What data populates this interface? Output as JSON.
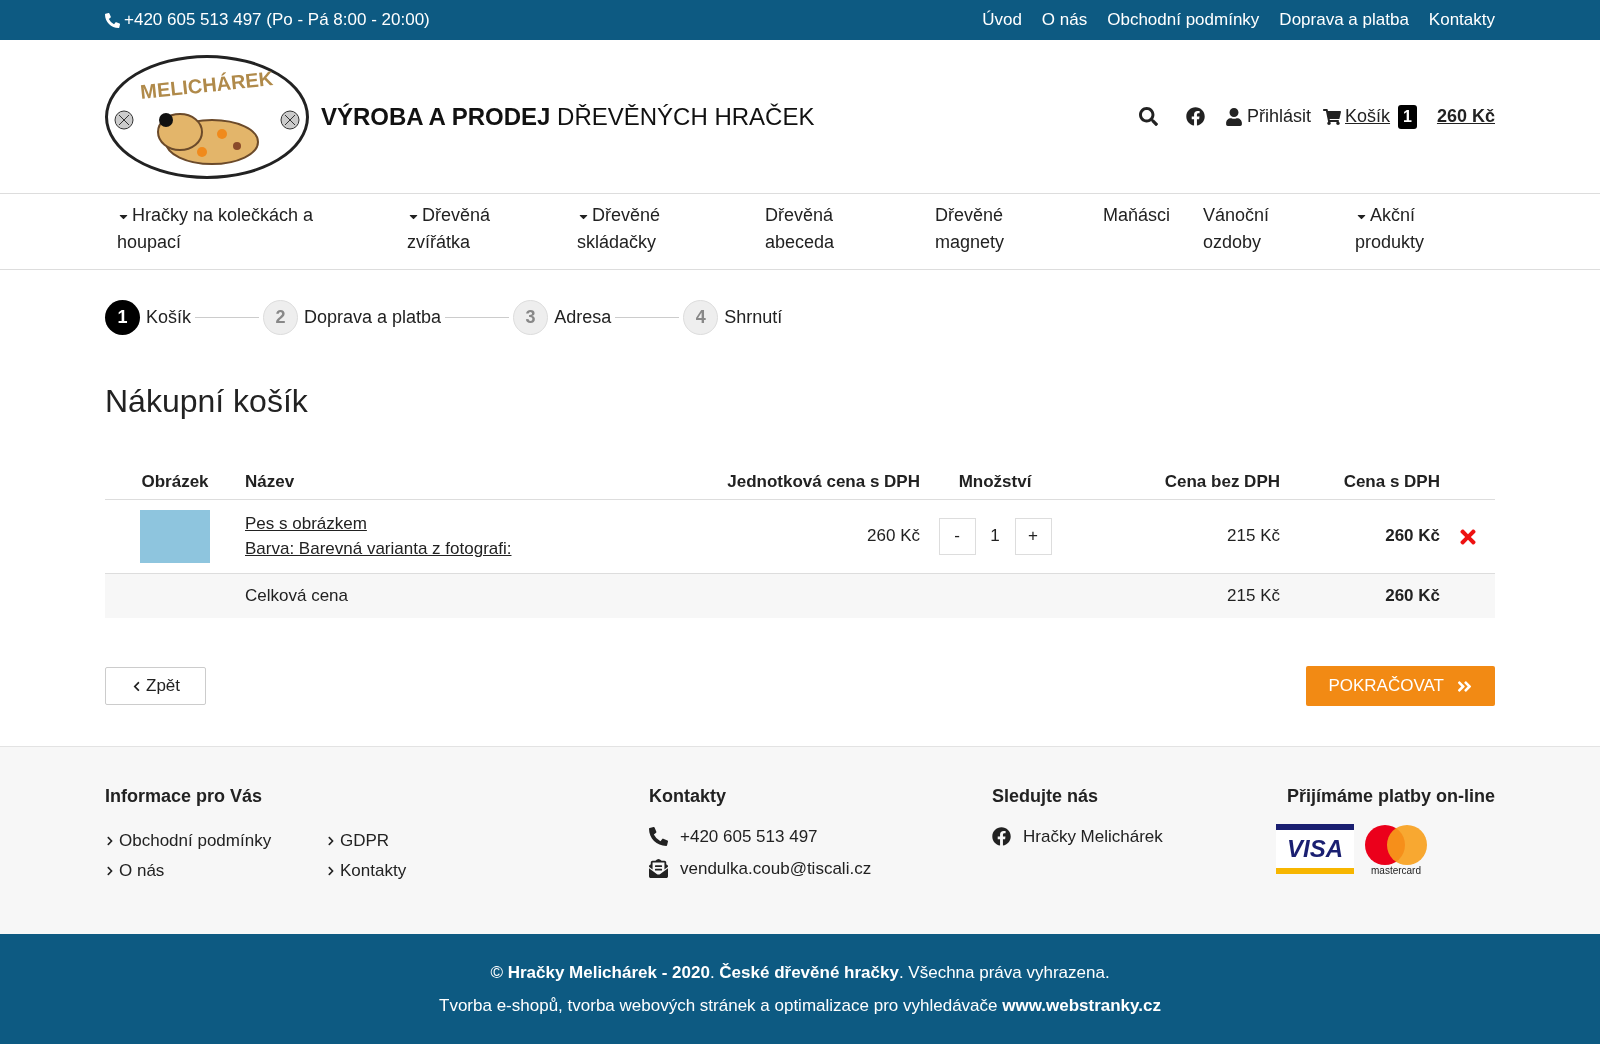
{
  "topbar": {
    "phone": "+420 605 513 497 (Po - Pá 8:00 - 20:00)",
    "links": [
      "Úvod",
      "O nás",
      "Obchodní podmínky",
      "Doprava a platba",
      "Kontakty"
    ]
  },
  "header": {
    "logo_text": "MELICHÁREK",
    "tagline_bold": "VÝROBA A PRODEJ",
    "tagline_rest": "DŘEVĚNÝCH HRAČEK",
    "login": "Přihlásit",
    "cart_label": "Košík",
    "cart_count": "1",
    "cart_total": "260 Kč"
  },
  "nav": [
    {
      "label": "Hračky na kolečkách a houpací",
      "dropdown": true
    },
    {
      "label": "Dřevěná zvířátka",
      "dropdown": true
    },
    {
      "label": "Dřevěné skládačky",
      "dropdown": true
    },
    {
      "label": "Dřevěná abeceda",
      "dropdown": false
    },
    {
      "label": "Dřevěné magnety",
      "dropdown": false
    },
    {
      "label": "Maňásci",
      "dropdown": false
    },
    {
      "label": "Vánoční ozdoby",
      "dropdown": false
    },
    {
      "label": "Akční produkty",
      "dropdown": true
    }
  ],
  "steps": [
    {
      "number": "1",
      "label": "Košík",
      "selected": true
    },
    {
      "number": "2",
      "label": "Doprava a platba",
      "selected": false
    },
    {
      "number": "3",
      "label": "Adresa",
      "selected": false
    },
    {
      "number": "4",
      "label": "Shrnutí",
      "selected": false
    }
  ],
  "title": "Nákupní košík",
  "table": {
    "columns": [
      "Obrázek",
      "Název",
      "Jednotková cena s DPH",
      "Množství",
      "Cena bez DPH",
      "Cena s DPH"
    ],
    "rows": [
      {
        "name": "Pes s obrázkem",
        "variant": "Barva: Barevná varianta z fotografi:",
        "unit_price": "260 Kč",
        "minus": "-",
        "quantity": "1",
        "plus": "+",
        "price_net": "215 Kč",
        "price_gross": "260 Kč"
      }
    ],
    "total": {
      "label": "Celková cena",
      "price_net": "215 Kč",
      "price_gross": "260 Kč"
    }
  },
  "back_button": "Zpět",
  "continue_button": "POKRAČOVAT",
  "footer": {
    "info_title": "Informace pro Vás",
    "info_links": [
      "Obchodní podmínky",
      "GDPR",
      "O nás",
      "Kontakty"
    ],
    "contact_title": "Kontakty",
    "phone": "+420 605 513 497",
    "email": "vendulka.coub@tiscali.cz",
    "follow_title": "Sledujte nás",
    "facebook": "Hračky Melichárek",
    "payments_title": "Přijímáme platby on-line",
    "visa": "VISA",
    "mastercard": "mastercard"
  },
  "bottom": {
    "line1": "© **Hračky Melichárek - 2020**. **České dřevěné hračky**. Všechna práva vyhrazena.",
    "line2": "Tvorba e-shopů, tvorba webových stránek a optimalizace pro vyhledávače **www.webstranky.cz**"
  }
}
